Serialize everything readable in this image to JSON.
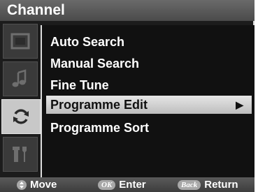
{
  "menu_title": "Channel",
  "sidebar": {
    "tabs": [
      {
        "icon": "screen-icon",
        "active": false
      },
      {
        "icon": "music-note-icon",
        "active": false
      },
      {
        "icon": "refresh-icon",
        "active": true
      },
      {
        "icon": "tools-icon",
        "active": false
      }
    ]
  },
  "menu": {
    "items": [
      {
        "label": "Auto Search"
      },
      {
        "label": "Manual Search"
      },
      {
        "label": "Fine Tune"
      },
      {
        "label": "Programme Edit",
        "selected": true,
        "arrow": "▶"
      },
      {
        "label": "Programme Sort"
      }
    ]
  },
  "footer": {
    "move_label": "Move",
    "ok_key": "OK",
    "enter_label": "Enter",
    "back_key": "Back",
    "return_label": "Return"
  }
}
